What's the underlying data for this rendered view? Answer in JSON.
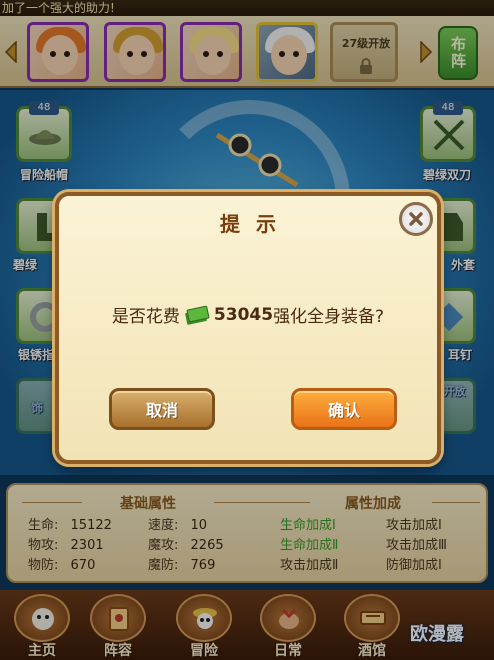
{
  "banner": {
    "text": "加了一个强大的助力!"
  },
  "portraits": {
    "locked_slot_label": "27级开放",
    "formation_button": "布阵"
  },
  "equipment": {
    "left": [
      {
        "level": "48",
        "label": "冒险船帽"
      },
      {
        "level": "",
        "label": "碧绿"
      },
      {
        "level": "",
        "label": "银锈指"
      },
      {
        "level": "",
        "label": "饰"
      }
    ],
    "right": [
      {
        "level": "48",
        "label": "碧绿双刀"
      },
      {
        "level": "",
        "label": "外套"
      },
      {
        "level": "",
        "label": "耳钉"
      },
      {
        "level": "",
        "label": "级开放"
      }
    ]
  },
  "dialog": {
    "title": "提示",
    "prompt_prefix": "是否花费",
    "amount": "53045",
    "prompt_suffix": "强化全身装备?",
    "cancel_label": "取消",
    "confirm_label": "确认"
  },
  "attributes": {
    "basic_title": "基础属性",
    "bonus_title": "属性加成",
    "basic": [
      {
        "label": "生命:",
        "value": "15122"
      },
      {
        "label": "速度:",
        "value": "10"
      },
      {
        "label": "物攻:",
        "value": "2301"
      },
      {
        "label": "魔攻:",
        "value": "2265"
      },
      {
        "label": "物防:",
        "value": "670"
      },
      {
        "label": "魔防:",
        "value": "769"
      }
    ],
    "bonus": [
      "生命加成Ⅰ",
      "攻击加成Ⅰ",
      "生命加成Ⅱ",
      "攻击加成Ⅲ",
      "攻击加成Ⅱ",
      "防御加成Ⅰ"
    ]
  },
  "nav": {
    "items": [
      {
        "label": "主页",
        "icon": "home-icon"
      },
      {
        "label": "阵容",
        "icon": "lineup-icon"
      },
      {
        "label": "冒险",
        "icon": "skull-icon"
      },
      {
        "label": "日常",
        "icon": "daily-icon"
      },
      {
        "label": "酒馆",
        "icon": "tavern-icon"
      }
    ],
    "watermark": "欧漫露"
  },
  "colors": {
    "dialog_border": "#8d5a26",
    "confirm": "#e8731a",
    "cancel": "#a8702c",
    "bonus_green": "#3a9a2a"
  }
}
